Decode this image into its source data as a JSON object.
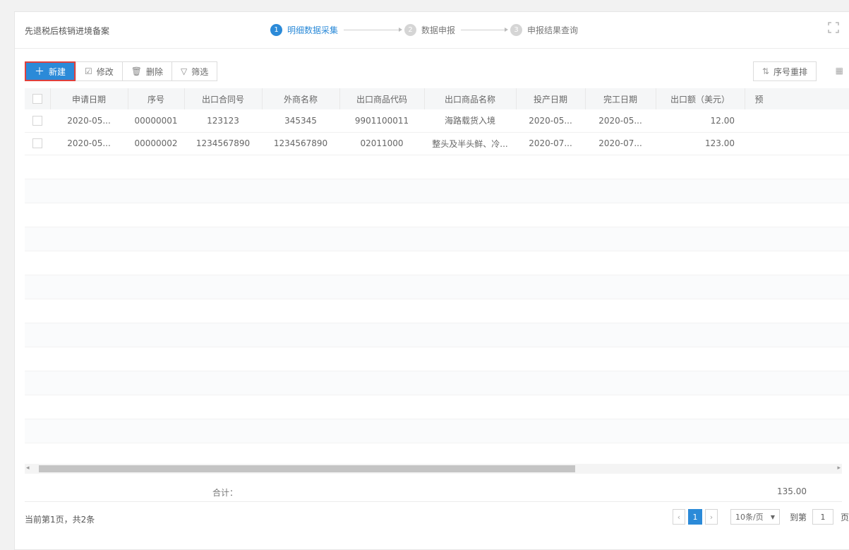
{
  "header": {
    "title": "先退税后核销进境备案",
    "steps": [
      {
        "num": "1",
        "label": "明细数据采集",
        "active": true
      },
      {
        "num": "2",
        "label": "数据申报",
        "active": false
      },
      {
        "num": "3",
        "label": "申报结果查询",
        "active": false
      }
    ]
  },
  "toolbar": {
    "new_label": "新建",
    "edit_label": "修改",
    "delete_label": "删除",
    "filter_label": "筛选",
    "reorder_label": "序号重排"
  },
  "table": {
    "columns": [
      "申请日期",
      "序号",
      "出口合同号",
      "外商名称",
      "出口商品代码",
      "出口商品名称",
      "投产日期",
      "完工日期",
      "出口额（美元）",
      "预"
    ],
    "rows": [
      [
        "2020-05...",
        "00000001",
        "123123",
        "345345",
        "9901100011",
        "海路载货入境",
        "2020-05...",
        "2020-05...",
        "12.00"
      ],
      [
        "2020-05...",
        "00000002",
        "1234567890",
        "1234567890",
        "02011000",
        "整头及半头鲜、冷...",
        "2020-07...",
        "2020-07...",
        "123.00"
      ]
    ]
  },
  "totals": {
    "label": "合计：",
    "value": "135.00"
  },
  "footer": {
    "summary": "当前第1页，共2条",
    "current_page": "1",
    "page_size": "10条/页",
    "goto_label": "到第",
    "goto_value": "1",
    "goto_unit": "页"
  },
  "colors": {
    "accent": "#2b8ad8",
    "highlight_border": "#e0403c"
  },
  "icons": {
    "new": "plus-icon",
    "edit": "edit-icon",
    "delete": "trash-icon",
    "filter": "filter-icon",
    "reorder": "sort-icon",
    "expand": "expand-icon",
    "columns": "grid-icon"
  }
}
